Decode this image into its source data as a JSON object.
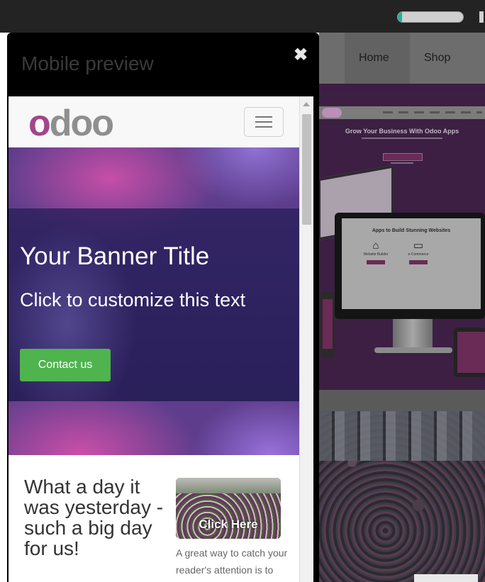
{
  "colors": {
    "odoo_purple": "#a24689",
    "odoo_gray": "#8f8f8f",
    "contact_button": "#4fb34e",
    "modal_bg": "#000000",
    "banner_purple": "#5d3d8c"
  },
  "topbar": {
    "progress_fraction": 0.07
  },
  "site": {
    "nav": {
      "home": "Home",
      "shop": "Shop"
    },
    "mock": {
      "title": "Grow Your Business With Odoo Apps",
      "apps_title": "Apps to Build Stunning Websites",
      "app1_label": "Website Builder",
      "app1_icon": "home-icon",
      "app2_label": "e-Commerce",
      "app2_icon": "card-icon"
    }
  },
  "modal": {
    "title": "Mobile preview",
    "close_icon": "close-icon",
    "close_glyph": "✖"
  },
  "preview": {
    "logo_first": "o",
    "logo_rest": "doo",
    "menu_icon": "hamburger-icon",
    "banner": {
      "title": "Your Banner Title",
      "text": "Click to customize this text",
      "button": "Contact us"
    },
    "article": {
      "heading": "What a day it was yesterday - such a big day for us!",
      "image_label": "Click Here",
      "caption": "A great way to catch your reader's attention is to"
    }
  }
}
